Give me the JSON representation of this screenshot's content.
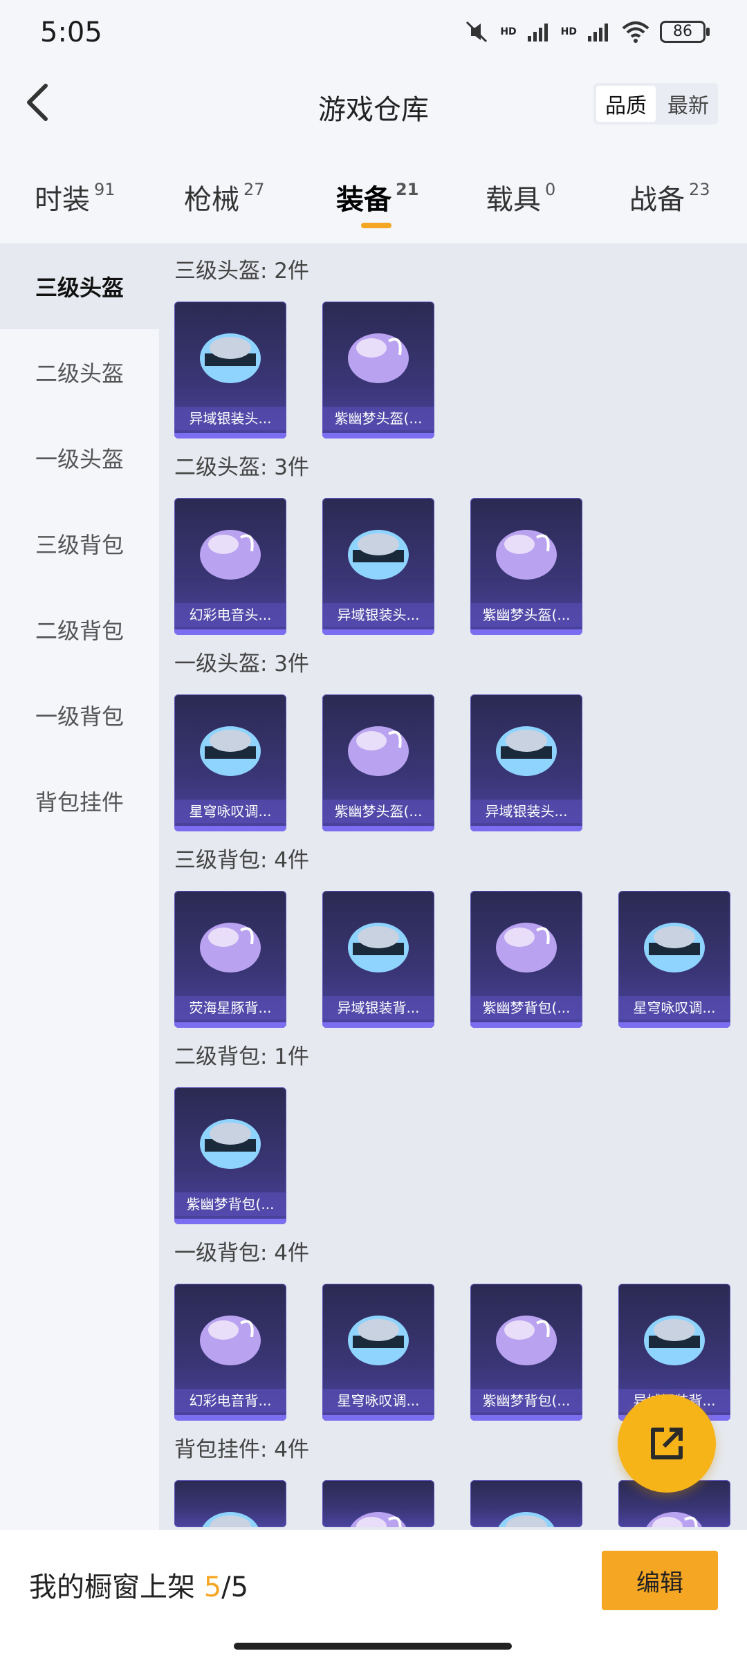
{
  "status": {
    "time": "5:05",
    "battery": "86",
    "hd1": "HD",
    "hd2": "HD"
  },
  "header": {
    "title": "游戏仓库",
    "sort_options": [
      "品质",
      "最新"
    ]
  },
  "tabs": [
    {
      "label": "时装",
      "count": "91"
    },
    {
      "label": "枪械",
      "count": "27"
    },
    {
      "label": "装备",
      "count": "21"
    },
    {
      "label": "载具",
      "count": "0"
    },
    {
      "label": "战备",
      "count": "23"
    }
  ],
  "sidebar": [
    "三级头盔",
    "二级头盔",
    "一级头盔",
    "三级背包",
    "二级背包",
    "一级背包",
    "背包挂件"
  ],
  "sections": [
    {
      "title": "三级头盔: 2件",
      "items": [
        "异域银装头...",
        "紫幽梦头盔(..."
      ]
    },
    {
      "title": "二级头盔: 3件",
      "items": [
        "幻彩电音头...",
        "异域银装头...",
        "紫幽梦头盔(..."
      ]
    },
    {
      "title": "一级头盔: 3件",
      "items": [
        "星穹咏叹调...",
        "紫幽梦头盔(...",
        "异域银装头..."
      ]
    },
    {
      "title": "三级背包: 4件",
      "items": [
        "荧海星豚背...",
        "异域银装背...",
        "紫幽梦背包(...",
        "星穹咏叹调..."
      ]
    },
    {
      "title": "二级背包: 1件",
      "items": [
        "紫幽梦背包(..."
      ]
    },
    {
      "title": "一级背包: 4件",
      "items": [
        "幻彩电音背...",
        "星穹咏叹调...",
        "紫幽梦背包(...",
        "异域银装背..."
      ]
    },
    {
      "title": "背包挂件: 4件",
      "items": [
        "",
        "",
        "",
        ""
      ]
    }
  ],
  "bottom": {
    "label": "我的橱窗上架",
    "current": "5",
    "separator": "/",
    "total": "5",
    "edit": "编辑"
  },
  "colors": {
    "accent": "#f5a623",
    "card_bg": "#3a3676"
  }
}
